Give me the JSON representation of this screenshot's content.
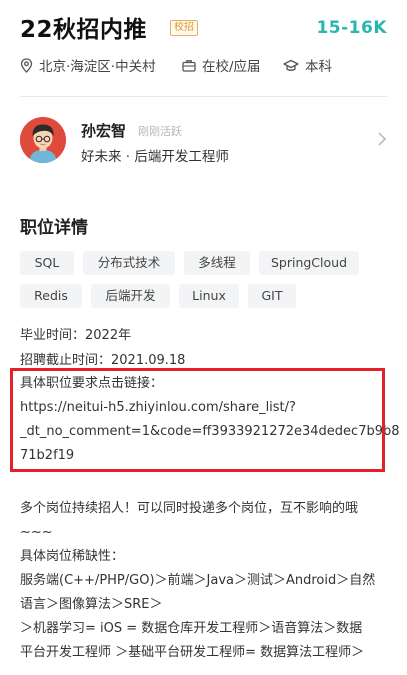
{
  "job": {
    "title": "22秋招内推",
    "badge": "校招",
    "salary": "15-16K",
    "location": "北京·海淀区·中关村",
    "status": "在校/应届",
    "education": "本科"
  },
  "recruiter": {
    "name": "孙宏智",
    "status": "刚刚活跃",
    "company_role": "好未来 · 后端开发工程师"
  },
  "section": {
    "title": "职位详情"
  },
  "tags": [
    "SQL",
    "分布式技术",
    "多线程",
    "SpringCloud",
    "Redis",
    "后端开发",
    "Linux",
    "GIT"
  ],
  "details": {
    "graduation": "毕业时间：2022年",
    "deadline": "招聘截止时间：2021.09.18",
    "link_label": "具体职位要求点击链接：",
    "link_line1": "https://neitui-h5.zhiyinlou.com/share_list/?",
    "link_line2": "_dt_no_comment=1&code=ff3933921272e34dedec7b9b8",
    "link_line3": "71b2f19"
  },
  "description": {
    "line1": "多个岗位持续招人！可以同时投递多个岗位，互不影响的哦",
    "line2": "~~~",
    "line3": "具体岗位稀缺性：",
    "line4": "服务端(C++/PHP/GO)＞前端＞Java＞测试＞Android＞自然",
    "line5": "语言＞图像算法＞SRE＞",
    "line6": "＞机器学习= iOS = 数据仓库开发工程师＞语音算法＞数据",
    "line7": "平台开发工程师 ＞基础平台研发工程师= 数据算法工程师＞"
  },
  "colors": {
    "accent": "#2bb5b1",
    "badge": "#d9952c",
    "highlight_box": "#e3212b"
  },
  "icons": [
    "location-icon",
    "briefcase-icon",
    "graduation-cap-icon",
    "chevron-right-icon"
  ]
}
